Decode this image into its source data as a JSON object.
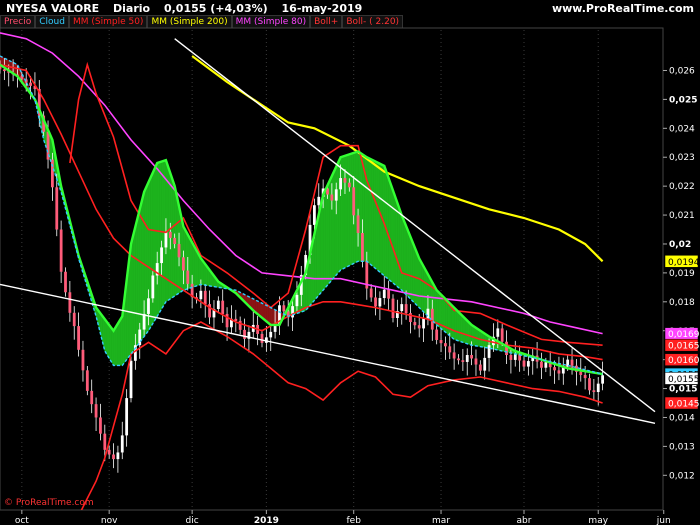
{
  "header": {
    "ticker": "NYESA VALORE",
    "period": "Diario",
    "price_change": "0,0155 (+4,03%)",
    "date": "16-may-2019",
    "site": "www.ProRealTime.com"
  },
  "legend": [
    {
      "label": "Precio",
      "color": "#ff4d6d"
    },
    {
      "label": "Cloud",
      "color": "#33ccff"
    },
    {
      "label": "MM (Simple 50)",
      "color": "#ff2020"
    },
    {
      "label": "MM (Simple 200)",
      "color": "#ffff00"
    },
    {
      "label": "MM (Simple 80)",
      "color": "#ff44ff"
    },
    {
      "label": "Boll+",
      "color": "#ff3333"
    },
    {
      "label": "Boll- ( 2.20)",
      "color": "#ff3333"
    }
  ],
  "watermark": "© ProRealTime.com",
  "chart_data": {
    "type": "candlestick",
    "title": "NYESA VALORE Diario",
    "x_ticks": [
      "oct",
      "nov",
      "dic",
      "2019",
      "feb",
      "mar",
      "abr",
      "may",
      "jun"
    ],
    "ylim": [
      0.0108,
      0.0274
    ],
    "y_ticks": [
      "0,026",
      "0,025",
      "0,024",
      "0,023",
      "0,022",
      "0,021",
      "0,02",
      "0,019",
      "0,018",
      "0,017",
      "0,016",
      "0,015",
      "0,014",
      "0,013",
      "0,012"
    ],
    "bold_ticks": [
      "0,025",
      "0,02",
      "0,015"
    ],
    "price_tags": [
      {
        "label": "0,0194",
        "value": 0.0194,
        "bg": "#ffff00",
        "fg": "#000000"
      },
      {
        "label": "0,0169",
        "value": 0.0169,
        "bg": "#ff44ff",
        "fg": "#ffffff"
      },
      {
        "label": "0,0165",
        "value": 0.0165,
        "bg": "#ff2020",
        "fg": "#ffffff"
      },
      {
        "label": "0,0160",
        "value": 0.016,
        "bg": "#ff2020",
        "fg": "#ffffff"
      },
      {
        "label": "0,0155",
        "value": 0.0155,
        "bg": "#33ccff",
        "fg": "#000000"
      },
      {
        "label": "0,0155",
        "value": 0.01535,
        "bg": "#ffffff",
        "fg": "#000000"
      },
      {
        "label": "0,0145",
        "value": 0.0145,
        "bg": "#ff2020",
        "fg": "#ffffff"
      }
    ],
    "last_close": 0.0155,
    "series": [
      {
        "name": "Precio",
        "color": "#ff4d6d",
        "points": [
          [
            0,
            0.0262
          ],
          [
            4,
            0.0258
          ],
          [
            8,
            0.0252
          ],
          [
            10,
            0.024
          ],
          [
            12,
            0.022
          ],
          [
            14,
            0.019
          ],
          [
            16,
            0.0175
          ],
          [
            18,
            0.0165
          ],
          [
            20,
            0.015
          ],
          [
            22,
            0.014
          ],
          [
            24,
            0.0128
          ],
          [
            26,
            0.0124
          ],
          [
            28,
            0.0135
          ],
          [
            30,
            0.016
          ],
          [
            32,
            0.017
          ],
          [
            34,
            0.018
          ],
          [
            36,
            0.0195
          ],
          [
            38,
            0.0205
          ],
          [
            40,
            0.02
          ],
          [
            42,
            0.019
          ],
          [
            44,
            0.018
          ],
          [
            46,
            0.0185
          ],
          [
            48,
            0.0175
          ],
          [
            50,
            0.018
          ],
          [
            52,
            0.017
          ],
          [
            54,
            0.0175
          ],
          [
            56,
            0.0168
          ],
          [
            58,
            0.0172
          ],
          [
            60,
            0.0165
          ],
          [
            62,
            0.0168
          ],
          [
            64,
            0.018
          ],
          [
            66,
            0.0175
          ],
          [
            68,
            0.0182
          ],
          [
            70,
            0.0195
          ],
          [
            72,
            0.0215
          ],
          [
            74,
            0.022
          ],
          [
            76,
            0.0215
          ],
          [
            78,
            0.0222
          ],
          [
            80,
            0.0218
          ],
          [
            82,
            0.0205
          ],
          [
            84,
            0.0185
          ],
          [
            86,
            0.0178
          ],
          [
            88,
            0.0183
          ],
          [
            90,
            0.0176
          ],
          [
            92,
            0.018
          ],
          [
            94,
            0.0173
          ],
          [
            96,
            0.017
          ],
          [
            98,
            0.0176
          ],
          [
            100,
            0.0168
          ],
          [
            102,
            0.0165
          ],
          [
            104,
            0.016
          ],
          [
            106,
            0.0158
          ],
          [
            108,
            0.0162
          ],
          [
            110,
            0.0157
          ],
          [
            112,
            0.0165
          ],
          [
            114,
            0.017
          ],
          [
            116,
            0.016
          ],
          [
            118,
            0.0163
          ],
          [
            120,
            0.0158
          ],
          [
            122,
            0.0161
          ],
          [
            124,
            0.0156
          ],
          [
            126,
            0.0159
          ],
          [
            128,
            0.0156
          ],
          [
            130,
            0.016
          ],
          [
            132,
            0.0155
          ],
          [
            134,
            0.0152
          ],
          [
            136,
            0.015
          ],
          [
            138,
            0.0155
          ]
        ]
      },
      {
        "name": "MM (Simple 50)",
        "color": "#ff2020",
        "points": [
          [
            0,
            0.0262
          ],
          [
            6,
            0.026
          ],
          [
            10,
            0.025
          ],
          [
            14,
            0.0238
          ],
          [
            18,
            0.0225
          ],
          [
            22,
            0.0212
          ],
          [
            26,
            0.0202
          ],
          [
            30,
            0.0196
          ],
          [
            36,
            0.019
          ],
          [
            42,
            0.0184
          ],
          [
            48,
            0.0178
          ],
          [
            54,
            0.0173
          ],
          [
            60,
            0.017
          ],
          [
            66,
            0.0175
          ],
          [
            70,
            0.0178
          ],
          [
            74,
            0.018
          ],
          [
            78,
            0.018
          ],
          [
            82,
            0.0179
          ],
          [
            86,
            0.0178
          ],
          [
            92,
            0.0176
          ],
          [
            98,
            0.0174
          ],
          [
            104,
            0.017
          ],
          [
            110,
            0.0167
          ],
          [
            116,
            0.0165
          ],
          [
            122,
            0.0164
          ],
          [
            128,
            0.0162
          ],
          [
            134,
            0.0161
          ],
          [
            138,
            0.016
          ]
        ]
      },
      {
        "name": "MM (Simple 200)",
        "color": "#ffff00",
        "points": [
          [
            44,
            0.0265
          ],
          [
            52,
            0.0256
          ],
          [
            60,
            0.0248
          ],
          [
            66,
            0.0242
          ],
          [
            72,
            0.024
          ],
          [
            80,
            0.0234
          ],
          [
            88,
            0.0225
          ],
          [
            96,
            0.022
          ],
          [
            104,
            0.0216
          ],
          [
            112,
            0.0212
          ],
          [
            120,
            0.0209
          ],
          [
            128,
            0.0205
          ],
          [
            134,
            0.02
          ],
          [
            138,
            0.0194
          ]
        ]
      },
      {
        "name": "MM (Simple 80)",
        "color": "#ff44ff",
        "points": [
          [
            0,
            0.0273
          ],
          [
            6,
            0.0271
          ],
          [
            12,
            0.0266
          ],
          [
            18,
            0.0258
          ],
          [
            24,
            0.0248
          ],
          [
            30,
            0.0236
          ],
          [
            36,
            0.0226
          ],
          [
            42,
            0.0215
          ],
          [
            48,
            0.0205
          ],
          [
            54,
            0.0196
          ],
          [
            60,
            0.019
          ],
          [
            66,
            0.0189
          ],
          [
            72,
            0.0188
          ],
          [
            78,
            0.0188
          ],
          [
            84,
            0.0186
          ],
          [
            90,
            0.0184
          ],
          [
            96,
            0.0182
          ],
          [
            102,
            0.0181
          ],
          [
            108,
            0.018
          ],
          [
            114,
            0.0178
          ],
          [
            120,
            0.0176
          ],
          [
            126,
            0.0173
          ],
          [
            132,
            0.0171
          ],
          [
            138,
            0.0169
          ]
        ]
      },
      {
        "name": "Boll+",
        "color": "#ff2020",
        "points": [
          [
            16,
            0.0228
          ],
          [
            18,
            0.025
          ],
          [
            20,
            0.0262
          ],
          [
            22,
            0.0252
          ],
          [
            26,
            0.0237
          ],
          [
            30,
            0.0215
          ],
          [
            34,
            0.0205
          ],
          [
            38,
            0.0204
          ],
          [
            42,
            0.0209
          ],
          [
            46,
            0.0196
          ],
          [
            52,
            0.019
          ],
          [
            58,
            0.0183
          ],
          [
            62,
            0.0178
          ],
          [
            66,
            0.0183
          ],
          [
            70,
            0.0205
          ],
          [
            74,
            0.023
          ],
          [
            78,
            0.0234
          ],
          [
            82,
            0.0234
          ],
          [
            84,
            0.0222
          ],
          [
            88,
            0.0207
          ],
          [
            92,
            0.019
          ],
          [
            96,
            0.0188
          ],
          [
            100,
            0.0184
          ],
          [
            104,
            0.0177
          ],
          [
            110,
            0.0176
          ],
          [
            116,
            0.0172
          ],
          [
            124,
            0.0167
          ],
          [
            130,
            0.0166
          ],
          [
            138,
            0.0165
          ]
        ]
      },
      {
        "name": "Boll-",
        "color": "#ff2020",
        "points": [
          [
            16,
            0.0104
          ],
          [
            18,
            0.0106
          ],
          [
            20,
            0.0112
          ],
          [
            22,
            0.0118
          ],
          [
            24,
            0.0126
          ],
          [
            26,
            0.0137
          ],
          [
            28,
            0.0148
          ],
          [
            30,
            0.0162
          ],
          [
            34,
            0.0166
          ],
          [
            38,
            0.0162
          ],
          [
            42,
            0.017
          ],
          [
            46,
            0.0173
          ],
          [
            52,
            0.0168
          ],
          [
            58,
            0.0162
          ],
          [
            62,
            0.0157
          ],
          [
            66,
            0.0152
          ],
          [
            70,
            0.015
          ],
          [
            74,
            0.0146
          ],
          [
            78,
            0.0152
          ],
          [
            82,
            0.0156
          ],
          [
            86,
            0.0154
          ],
          [
            90,
            0.0148
          ],
          [
            94,
            0.0147
          ],
          [
            98,
            0.0151
          ],
          [
            104,
            0.0153
          ],
          [
            110,
            0.0154
          ],
          [
            116,
            0.0152
          ],
          [
            122,
            0.015
          ],
          [
            128,
            0.0149
          ],
          [
            134,
            0.0147
          ],
          [
            138,
            0.0145
          ]
        ]
      },
      {
        "name": "Cloud",
        "color": "#33ccff",
        "points": [
          [
            0,
            0.0265
          ],
          [
            4,
            0.0262
          ],
          [
            8,
            0.025
          ],
          [
            10,
            0.0236
          ],
          [
            14,
            0.0218
          ],
          [
            18,
            0.0195
          ],
          [
            22,
            0.0175
          ],
          [
            24,
            0.0163
          ],
          [
            26,
            0.0158
          ],
          [
            28,
            0.0158
          ],
          [
            30,
            0.0162
          ],
          [
            34,
            0.017
          ],
          [
            38,
            0.018
          ],
          [
            42,
            0.0184
          ],
          [
            46,
            0.0186
          ],
          [
            50,
            0.0185
          ],
          [
            54,
            0.0184
          ],
          [
            58,
            0.0181
          ],
          [
            62,
            0.0178
          ],
          [
            66,
            0.0175
          ],
          [
            70,
            0.0177
          ],
          [
            74,
            0.0184
          ],
          [
            78,
            0.0191
          ],
          [
            82,
            0.0194
          ],
          [
            84,
            0.0194
          ],
          [
            88,
            0.0189
          ],
          [
            92,
            0.0184
          ],
          [
            96,
            0.0178
          ],
          [
            100,
            0.0172
          ],
          [
            104,
            0.0167
          ],
          [
            108,
            0.0165
          ],
          [
            112,
            0.0164
          ],
          [
            118,
            0.0162
          ],
          [
            124,
            0.016
          ],
          [
            130,
            0.0158
          ],
          [
            138,
            0.0155
          ]
        ]
      },
      {
        "name": "Cloud base",
        "color": "#33ff33",
        "points": [
          [
            0,
            0.0262
          ],
          [
            4,
            0.0258
          ],
          [
            8,
            0.025
          ],
          [
            12,
            0.0236
          ],
          [
            14,
            0.022
          ],
          [
            18,
            0.0196
          ],
          [
            22,
            0.0178
          ],
          [
            26,
            0.017
          ],
          [
            28,
            0.0175
          ],
          [
            30,
            0.02
          ],
          [
            33,
            0.0218
          ],
          [
            36,
            0.0228
          ],
          [
            38,
            0.0229
          ],
          [
            40,
            0.022
          ],
          [
            42,
            0.0206
          ],
          [
            46,
            0.0195
          ],
          [
            50,
            0.0187
          ],
          [
            54,
            0.0183
          ],
          [
            58,
            0.0177
          ],
          [
            62,
            0.0172
          ],
          [
            64,
            0.0172
          ],
          [
            66,
            0.0178
          ],
          [
            70,
            0.019
          ],
          [
            74,
            0.0217
          ],
          [
            78,
            0.023
          ],
          [
            82,
            0.0232
          ],
          [
            84,
            0.023
          ],
          [
            88,
            0.0227
          ],
          [
            92,
            0.021
          ],
          [
            96,
            0.0195
          ],
          [
            100,
            0.0184
          ],
          [
            104,
            0.0178
          ],
          [
            108,
            0.0172
          ],
          [
            112,
            0.0168
          ],
          [
            118,
            0.0163
          ],
          [
            124,
            0.016
          ],
          [
            130,
            0.0157
          ],
          [
            138,
            0.0155
          ]
        ]
      }
    ],
    "trendlines": [
      {
        "from": [
          0.0,
          0.0186
        ],
        "to": [
          150.0,
          0.0138
        ],
        "color": "#ffffff"
      },
      {
        "from": [
          40.0,
          0.0271
        ],
        "to": [
          150.0,
          0.0142
        ],
        "color": "#ffffff"
      }
    ]
  }
}
